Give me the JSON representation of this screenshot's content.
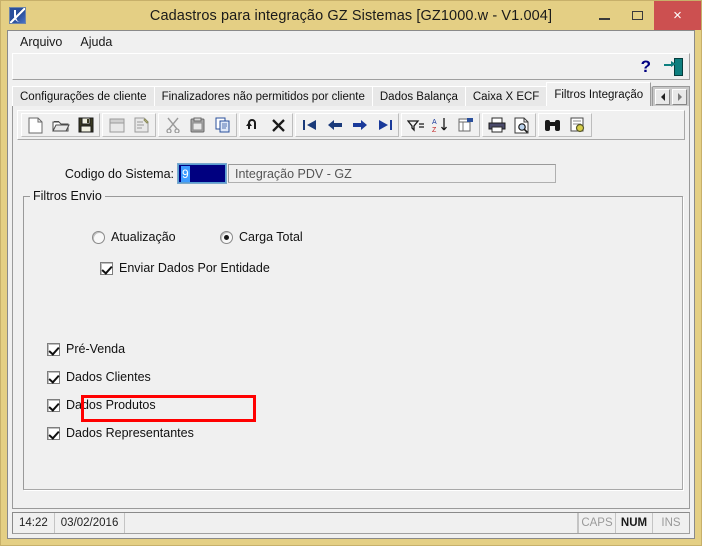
{
  "window": {
    "title": "Cadastros para integração GZ Sistemas [GZ1000.w - V1.004]",
    "app_icon": "document-blue-icon",
    "minimize_label": "Minimizar",
    "maximize_label": "Maximizar",
    "close_label": "×"
  },
  "menubar": {
    "items": [
      {
        "label": "Arquivo"
      },
      {
        "label": "Ajuda"
      }
    ]
  },
  "helpbar": {
    "help_glyph": "?",
    "exit_icon": "exit-door-icon"
  },
  "tabs": {
    "items": [
      {
        "label": "Configurações de cliente",
        "active": false
      },
      {
        "label": "Finalizadores não permitidos por cliente",
        "active": false
      },
      {
        "label": "Dados Balança",
        "active": false
      },
      {
        "label": "Caixa X ECF",
        "active": false
      },
      {
        "label": "Filtros Integração",
        "active": true
      }
    ],
    "scroll_left": "◀",
    "scroll_right": "▶"
  },
  "toolbar": {
    "groups": [
      {
        "buttons": [
          {
            "icon": "new-document-icon",
            "label": "Novo"
          },
          {
            "icon": "open-folder-icon",
            "label": "Abrir"
          },
          {
            "icon": "save-disk-icon",
            "label": "Salvar"
          }
        ]
      },
      {
        "buttons": [
          {
            "icon": "window-icon",
            "label": "Janela"
          },
          {
            "icon": "properties-icon",
            "label": "Propriedades"
          }
        ]
      },
      {
        "buttons": [
          {
            "icon": "scissors-cut-icon",
            "label": "Recortar"
          },
          {
            "icon": "clipboard-paste-icon",
            "label": "Colar"
          },
          {
            "icon": "copy-icon",
            "label": "Copiar"
          }
        ]
      },
      {
        "buttons": [
          {
            "icon": "undo-arrow-icon",
            "label": "Desfazer"
          },
          {
            "icon": "delete-x-icon",
            "label": "Excluir"
          }
        ]
      },
      {
        "buttons": [
          {
            "icon": "first-record-icon",
            "label": "Primeiro"
          },
          {
            "icon": "previous-record-icon",
            "label": "Anterior"
          },
          {
            "icon": "next-record-icon",
            "label": "Próximo"
          },
          {
            "icon": "last-record-icon",
            "label": "Último"
          }
        ]
      },
      {
        "buttons": [
          {
            "icon": "filter-icon",
            "label": "Filtrar"
          },
          {
            "icon": "sort-az-icon",
            "label": "Ordenar"
          },
          {
            "icon": "grid-layout-icon",
            "label": "Layout"
          }
        ]
      },
      {
        "buttons": [
          {
            "icon": "printer-icon",
            "label": "Imprimir"
          },
          {
            "icon": "print-preview-icon",
            "label": "Visualizar impressão"
          }
        ]
      },
      {
        "buttons": [
          {
            "icon": "binoculars-search-icon",
            "label": "Pesquisar"
          },
          {
            "icon": "advanced-search-icon",
            "label": "Pesquisa avançada"
          }
        ]
      }
    ]
  },
  "form": {
    "codigo_label": "Codigo do Sistema:",
    "codigo_value": "9",
    "descricao_value": "Integração PDV - GZ",
    "groupbox_title": "Filtros Envio",
    "radios": [
      {
        "label": "Atualização",
        "checked": false
      },
      {
        "label": "Carga Total",
        "checked": true
      }
    ],
    "entidade_checkbox": {
      "label": "Enviar Dados Por Entidade",
      "checked": true
    },
    "checkboxes": [
      {
        "label": "Pré-Venda",
        "checked": true
      },
      {
        "label": "Dados Clientes",
        "checked": true
      },
      {
        "label": "Dados Produtos",
        "checked": true
      },
      {
        "label": "Dados Representantes",
        "checked": true
      }
    ]
  },
  "highlight": {
    "color": "#ff0000",
    "target": "Enviar Dados Por Entidade"
  },
  "statusbar": {
    "time": "14:22",
    "date": "03/02/2016",
    "message": "",
    "indicators": [
      {
        "label": "CAPS",
        "active": false
      },
      {
        "label": "NUM",
        "active": true
      },
      {
        "label": "INS",
        "active": false
      }
    ]
  },
  "colors": {
    "title_bar": "#e4cf84",
    "close_button": "#cc5050",
    "client_bg": "#f0f0f0",
    "input_focus_bg": "#000080",
    "selection": "#3d9bff",
    "highlight": "#ff0000"
  }
}
